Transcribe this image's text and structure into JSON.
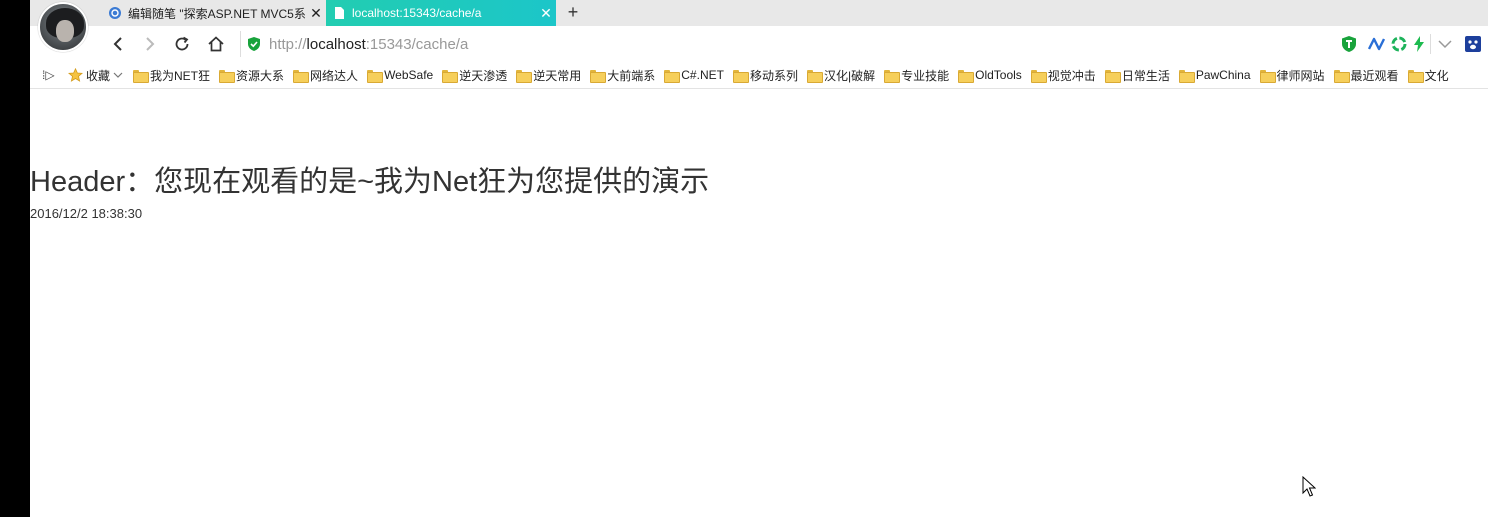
{
  "tabs": [
    {
      "label": "编辑随笔 \"探索ASP.NET MVC5系",
      "close": "✕",
      "icon": "site-icon",
      "active": false
    },
    {
      "label": "localhost:15343/cache/a",
      "close": "✕",
      "icon": "page-icon",
      "active": true
    }
  ],
  "new_tab_label": "+",
  "address": {
    "scheme": "http://",
    "host": "localhost",
    "rest": ":15343/cache/a"
  },
  "bookmarks": {
    "favorites_label": "收藏",
    "items": [
      "我为NET狂",
      "资源大系",
      "网络达人",
      "WebSafe",
      "逆天渗透",
      "逆天常用",
      "大前端系",
      "C#.NET",
      "移动系列",
      "汉化|破解",
      "专业技能",
      "OldTools",
      "视觉冲击",
      "日常生活",
      "PawChina",
      "律师网站",
      "最近观看",
      "文化"
    ]
  },
  "page": {
    "heading": "Header：您现在观看的是~我为Net狂为您提供的演示",
    "timestamp": "2016/12/2 18:38:30"
  },
  "colors": {
    "active_tab": "#22cdb1",
    "shield": "#19a33c"
  }
}
